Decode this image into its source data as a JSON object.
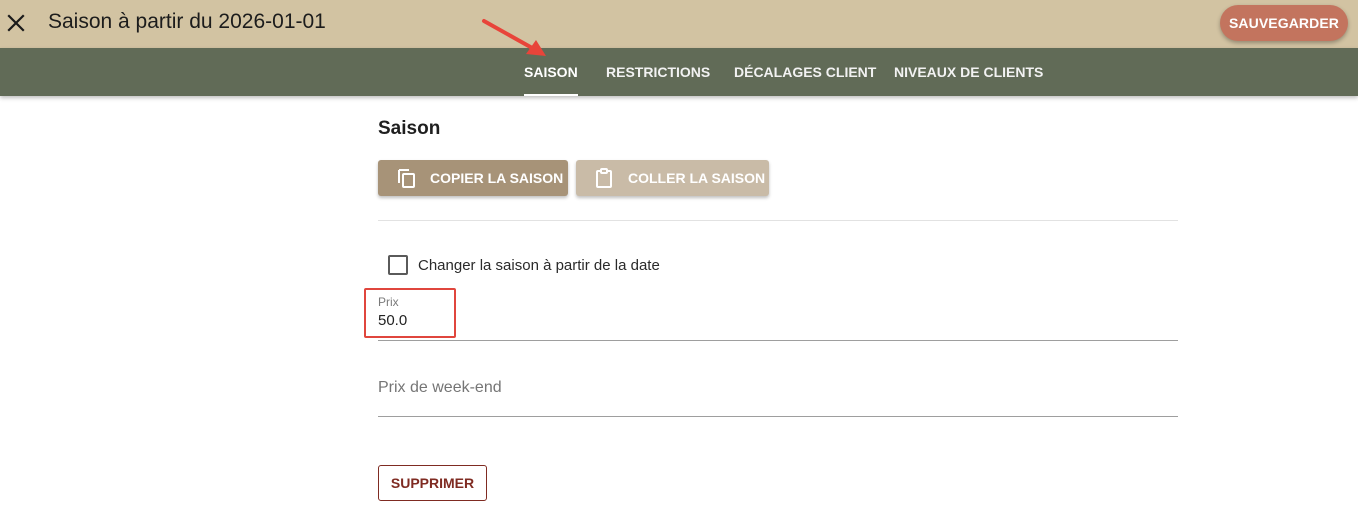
{
  "header": {
    "title": "Saison à partir du 2026-01-01",
    "close_icon": "close-icon",
    "save_label": "SAUVEGARDER"
  },
  "tabs": [
    {
      "label": "SAISON",
      "active": true
    },
    {
      "label": "RESTRICTIONS",
      "active": false
    },
    {
      "label": "DÉCALAGES CLIENT",
      "active": false
    },
    {
      "label": "NIVEAUX DE CLIENTS",
      "active": false
    }
  ],
  "section": {
    "title": "Saison",
    "copy_label": "COPIER LA SAISON",
    "copy_icon": "copy-icon",
    "paste_label": "COLLER LA SAISON",
    "paste_icon": "clipboard-icon",
    "paste_enabled": false
  },
  "form": {
    "change_checkbox_label": "Changer la saison à partir de la date",
    "change_checkbox_checked": false,
    "price_label": "Prix",
    "price_value": "50.0",
    "weekend_price_placeholder": "Prix de week-end",
    "weekend_price_value": ""
  },
  "delete_label": "SUPPRIMER",
  "colors": {
    "header_bg": "#d2c3a2",
    "tabbar_bg": "#616b57",
    "save_button": "#c3745e",
    "copy_button": "#a79378",
    "paste_button_disabled": "#c9bba7",
    "delete_border": "#7f2b22",
    "annotation_red": "#e0463d"
  }
}
